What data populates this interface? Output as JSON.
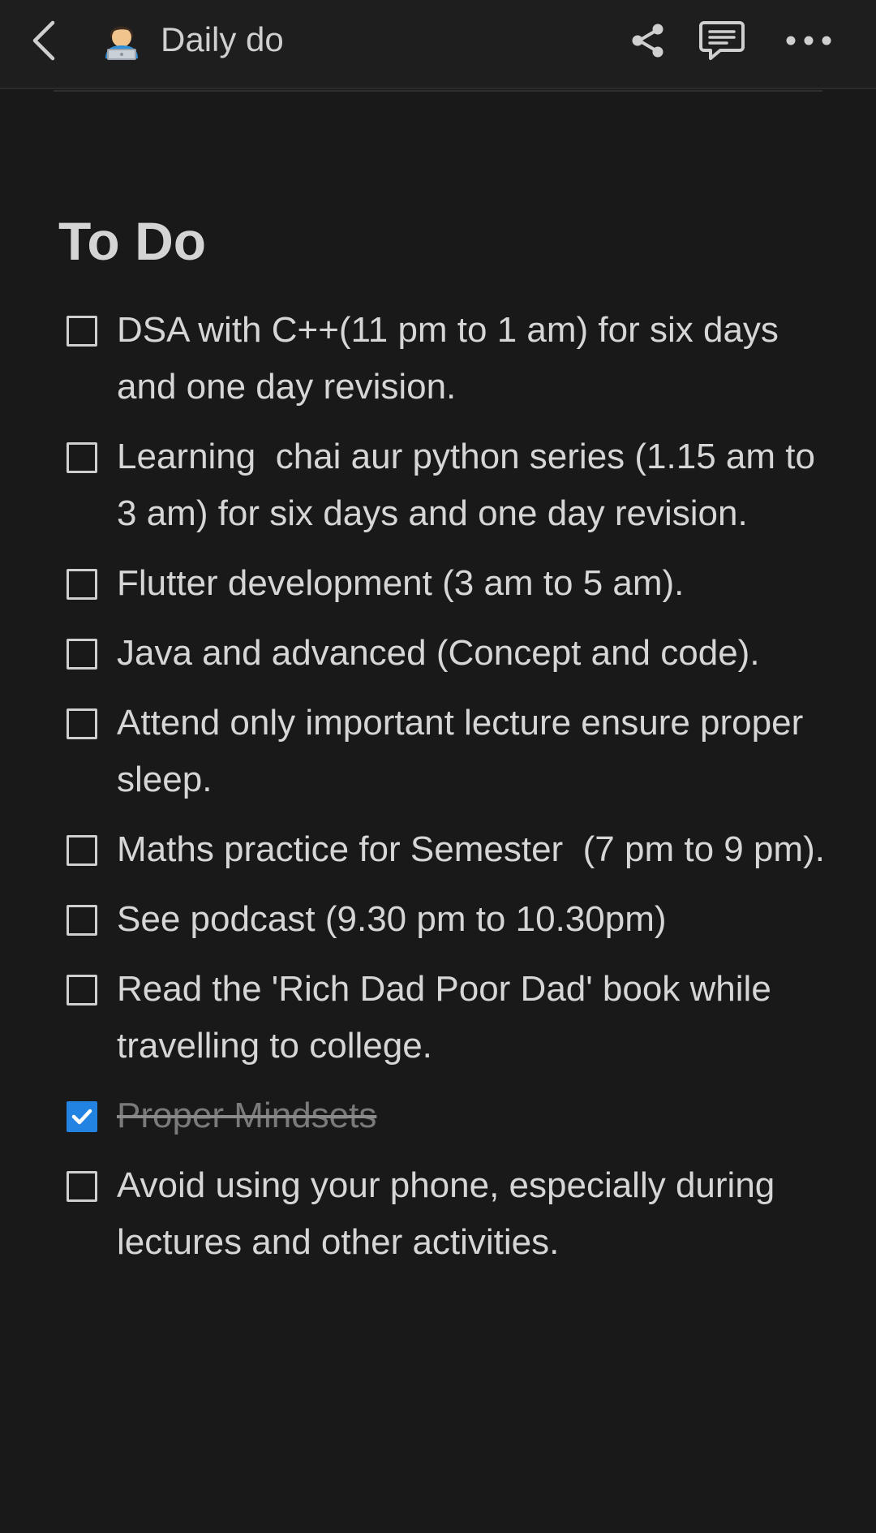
{
  "header": {
    "page_emoji": "🧑‍💻",
    "page_title": "Daily do",
    "icons": {
      "back": "chevron-left-icon",
      "share": "share-icon",
      "comment": "comment-icon",
      "more": "more-horizontal-icon"
    }
  },
  "page": {
    "heading": "To Do",
    "todos": [
      {
        "text": "DSA with C++(11 pm to 1 am) for six days and one day revision.",
        "checked": false
      },
      {
        "text": "Learning  chai aur python series (1.15 am to  3 am) for six days and one day revision.",
        "checked": false
      },
      {
        "text": "Flutter development (3 am to 5 am).",
        "checked": false
      },
      {
        "text": "Java and advanced (Concept and code).",
        "checked": false
      },
      {
        "text": "Attend only important lecture ensure proper sleep.",
        "checked": false
      },
      {
        "text": "Maths practice for Semester  (7 pm to 9 pm).",
        "checked": false
      },
      {
        "text": "See podcast (9.30 pm to 10.30pm)",
        "checked": false
      },
      {
        "text": "Read the 'Rich Dad Poor Dad' book while travelling to college.",
        "checked": false
      },
      {
        "text": "Proper Mindsets",
        "checked": true
      },
      {
        "text": "Avoid using your phone, especially during lectures and other activities.",
        "checked": false
      }
    ]
  },
  "colors": {
    "background": "#191919",
    "text": "#d6d6d6",
    "checkbox_checked": "#2383e2",
    "done_text": "#7a7a7a"
  }
}
